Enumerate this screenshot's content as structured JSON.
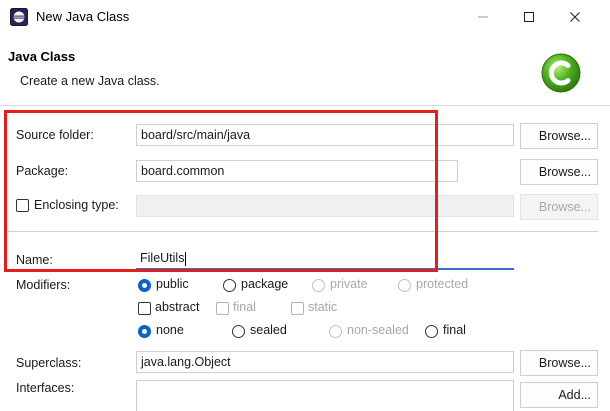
{
  "window": {
    "title": "New Java Class",
    "minimize_label": "—",
    "maximize_label": "☐",
    "close_label": "✕"
  },
  "header": {
    "title": "Java Class",
    "description": "Create a new Java class."
  },
  "source_folder": {
    "label": "Source folder:",
    "value": "board/src/main/java",
    "button": "Browse..."
  },
  "package": {
    "label": "Package:",
    "value": "board.common",
    "button": "Browse..."
  },
  "enclosing_type": {
    "label": "Enclosing type:",
    "value": "",
    "button": "Browse..."
  },
  "name": {
    "label": "Name:",
    "value": "FileUtils"
  },
  "modifiers": {
    "label": "Modifiers:",
    "access": [
      {
        "label": "public",
        "checked": true,
        "enabled": true
      },
      {
        "label": "package",
        "checked": false,
        "enabled": true
      },
      {
        "label": "private",
        "checked": false,
        "enabled": false
      },
      {
        "label": "protected",
        "checked": false,
        "enabled": false
      }
    ],
    "flags": [
      {
        "label": "abstract",
        "enabled": true
      },
      {
        "label": "final",
        "enabled": false
      },
      {
        "label": "static",
        "enabled": false
      }
    ],
    "sealing": [
      {
        "label": "none",
        "checked": true,
        "enabled": true
      },
      {
        "label": "sealed",
        "checked": false,
        "enabled": true
      },
      {
        "label": "non-sealed",
        "checked": false,
        "enabled": false
      },
      {
        "label": "final",
        "checked": false,
        "enabled": true
      }
    ]
  },
  "superclass": {
    "label": "Superclass:",
    "value": "java.lang.Object",
    "button": "Browse..."
  },
  "interfaces": {
    "label": "Interfaces:",
    "button": "Add..."
  },
  "colors": {
    "highlight": "#e0201c",
    "accent": "#0a63c9",
    "badge": "#4caf1e"
  }
}
